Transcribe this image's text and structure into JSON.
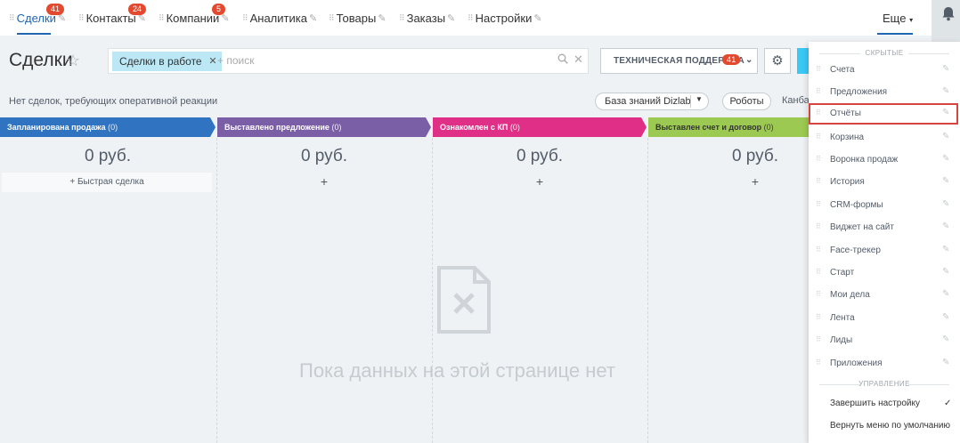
{
  "nav": {
    "items": [
      {
        "label": "Сделки",
        "badge": "41"
      },
      {
        "label": "Контакты",
        "badge": "24"
      },
      {
        "label": "Компании",
        "badge": "5"
      },
      {
        "label": "Аналитика",
        "badge": null
      },
      {
        "label": "Товары",
        "badge": null
      },
      {
        "label": "Заказы",
        "badge": null
      },
      {
        "label": "Настройки",
        "badge": null
      }
    ],
    "more_label": "Еще",
    "active_color": "#2066b0"
  },
  "header": {
    "title": "Сделки",
    "filter_chip": "Сделки в работе",
    "search_placeholder": "+ поиск",
    "support_label": "ТЕХНИЧЕСКАЯ ПОДДЕРЖКА",
    "support_badge": "41"
  },
  "toolbar": {
    "notice": "Нет сделок, требующих оперативной реакции",
    "knowledge_base": "База знаний Dizlab",
    "robots": "Роботы",
    "view_label": "Канба"
  },
  "kanban": {
    "stages": [
      {
        "name": "Запланирована продажа",
        "count": "(0)",
        "sum": "0 руб.",
        "color": "#2f73c1",
        "action": "Быстрая сделка"
      },
      {
        "name": "Выставлено предложение",
        "count": "(0)",
        "sum": "0 руб.",
        "color": "#7b5fa6",
        "action": "+"
      },
      {
        "name": "Ознакомлен с КП",
        "count": "(0)",
        "sum": "0 руб.",
        "color": "#df2f86",
        "action": "+"
      },
      {
        "name": "Выставлен счет и договор",
        "count": "(0)",
        "sum": "0 руб.",
        "color": "#9cc952",
        "action": "+"
      }
    ],
    "empty_message": "Пока данных на этой странице нет"
  },
  "menu": {
    "hidden_section": "СКРЫТЫЕ",
    "items": [
      {
        "label": "Счета"
      },
      {
        "label": "Предложения"
      },
      {
        "label": "Отчёты"
      },
      {
        "label": "Корзина"
      },
      {
        "label": "Воронка продаж"
      },
      {
        "label": "История"
      },
      {
        "label": "CRM-формы"
      },
      {
        "label": "Виджет на сайт"
      },
      {
        "label": "Face-трекер"
      },
      {
        "label": "Старт"
      },
      {
        "label": "Мои дела"
      },
      {
        "label": "Лента"
      },
      {
        "label": "Лиды"
      },
      {
        "label": "Приложения"
      }
    ],
    "manage_section": "УПРАВЛЕНИЕ",
    "finish_setup": "Завершить настройку",
    "reset_menu": "Вернуть меню по умолчанию",
    "highlight_color": "#d6453f"
  }
}
